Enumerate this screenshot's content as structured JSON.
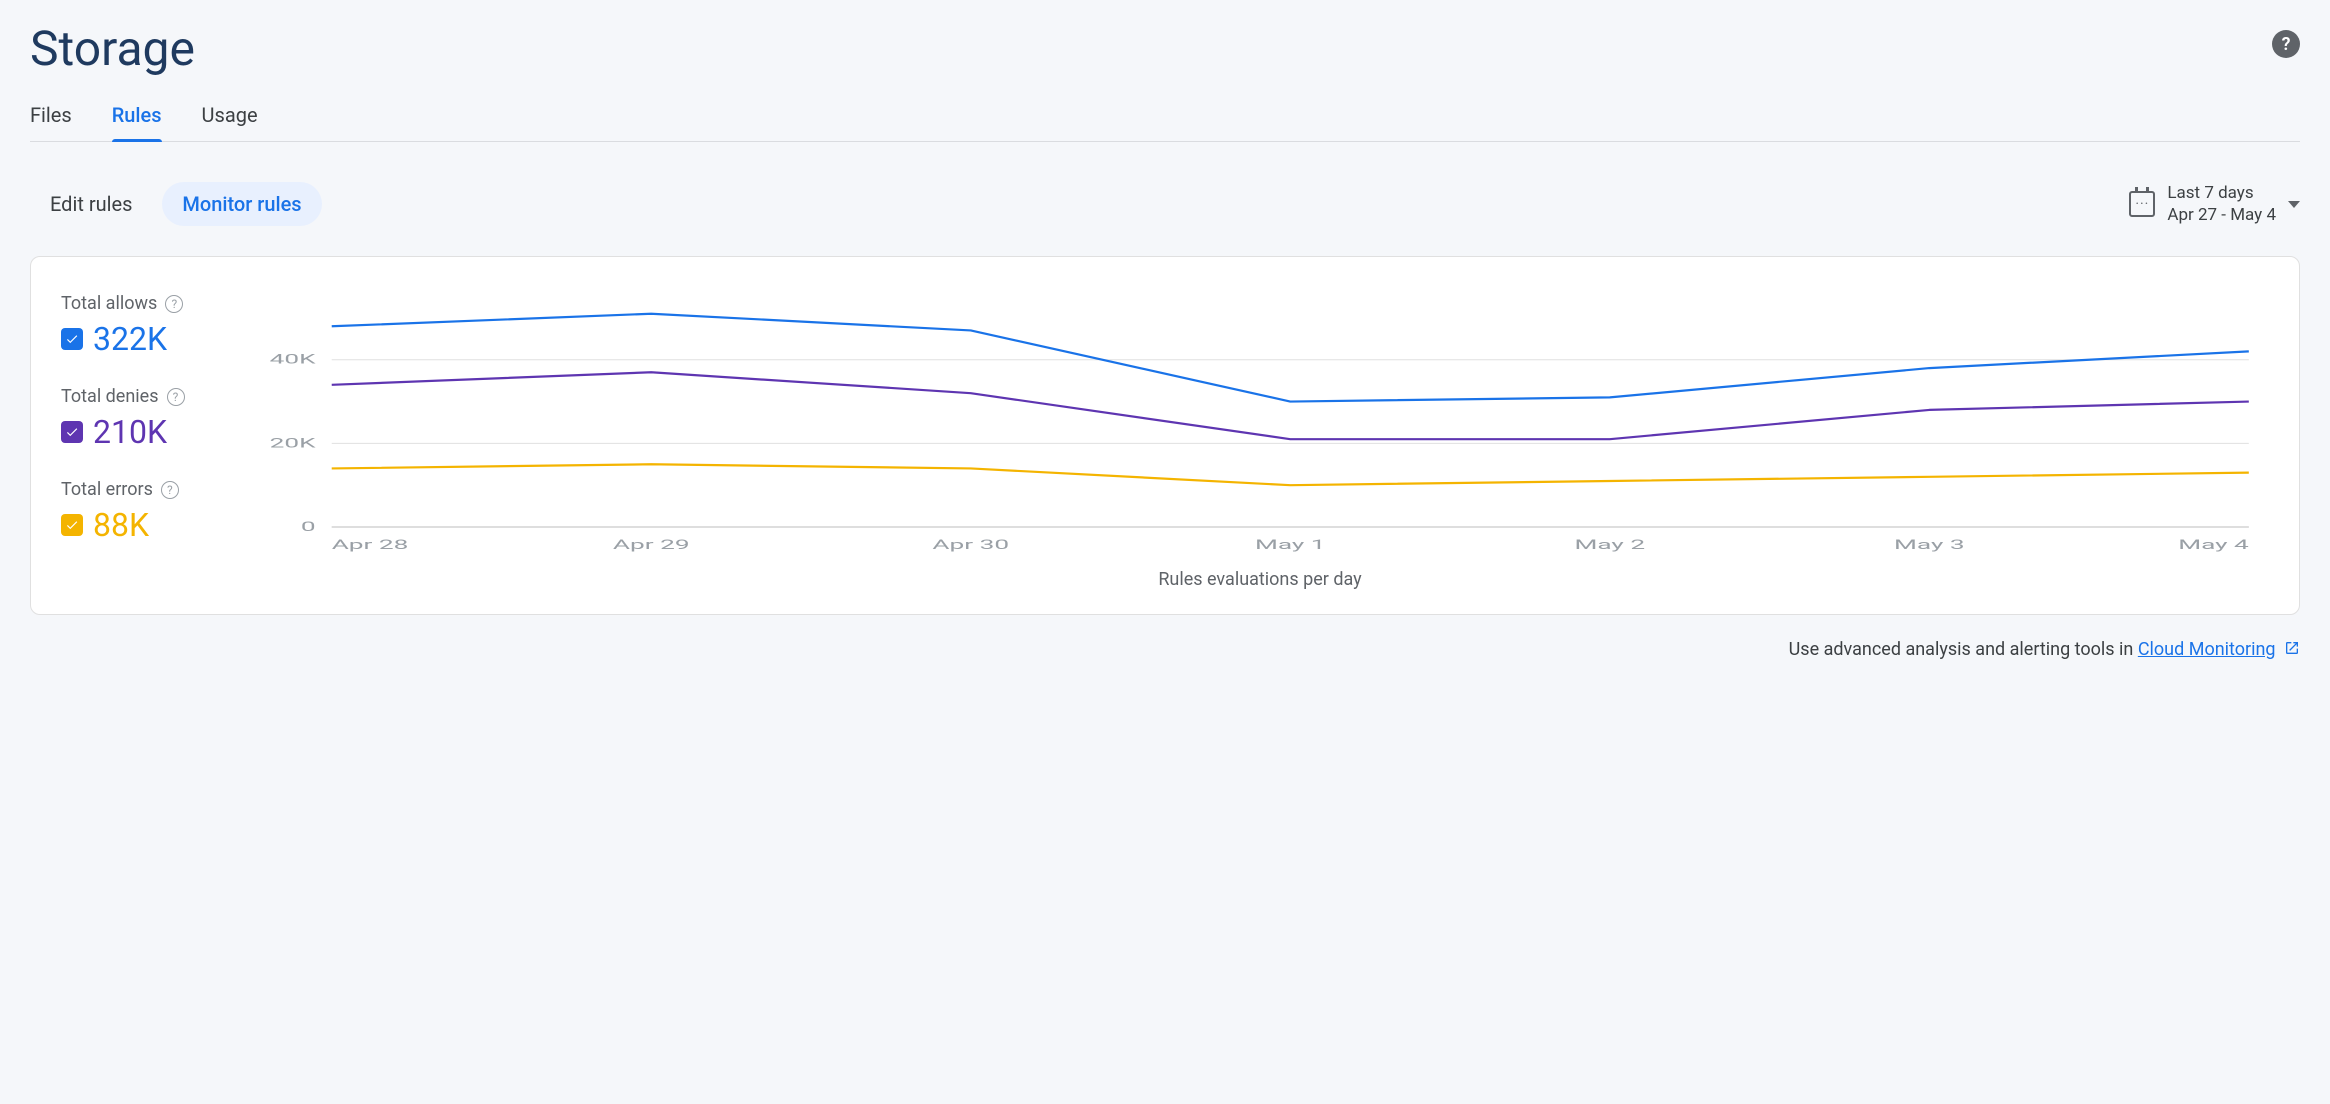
{
  "page": {
    "title": "Storage"
  },
  "tabs": [
    {
      "label": "Files",
      "active": false
    },
    {
      "label": "Rules",
      "active": true
    },
    {
      "label": "Usage",
      "active": false
    }
  ],
  "subtabs": [
    {
      "label": "Edit rules",
      "active": false
    },
    {
      "label": "Monitor rules",
      "active": true
    }
  ],
  "datepicker": {
    "label": "Last 7 days",
    "range": "Apr 27 - May 4"
  },
  "legend": {
    "allows": {
      "label": "Total allows",
      "value": "322K",
      "color": "#1a73e8"
    },
    "denies": {
      "label": "Total denies",
      "value": "210K",
      "color": "#5e35b1"
    },
    "errors": {
      "label": "Total errors",
      "value": "88K",
      "color": "#f4b400"
    }
  },
  "chart_data": {
    "type": "line",
    "xlabel": "Rules evaluations per day",
    "ylabel": "",
    "ylim": [
      0,
      55000
    ],
    "y_ticks": [
      0,
      20000,
      40000
    ],
    "y_tick_labels": [
      "0",
      "20K",
      "40K"
    ],
    "categories": [
      "Apr 28",
      "Apr 29",
      "Apr 30",
      "May 1",
      "May 2",
      "May 3",
      "May 4"
    ],
    "series": [
      {
        "name": "Total allows",
        "color": "#1a73e8",
        "values": [
          48000,
          51000,
          47000,
          30000,
          31000,
          38000,
          42000
        ]
      },
      {
        "name": "Total denies",
        "color": "#5e35b1",
        "values": [
          34000,
          37000,
          32000,
          21000,
          21000,
          28000,
          30000
        ]
      },
      {
        "name": "Total errors",
        "color": "#f4b400",
        "values": [
          14000,
          15000,
          14000,
          10000,
          11000,
          12000,
          13000
        ]
      }
    ]
  },
  "footer": {
    "prefix": "Use advanced analysis and alerting tools in ",
    "link_text": "Cloud Monitoring"
  }
}
